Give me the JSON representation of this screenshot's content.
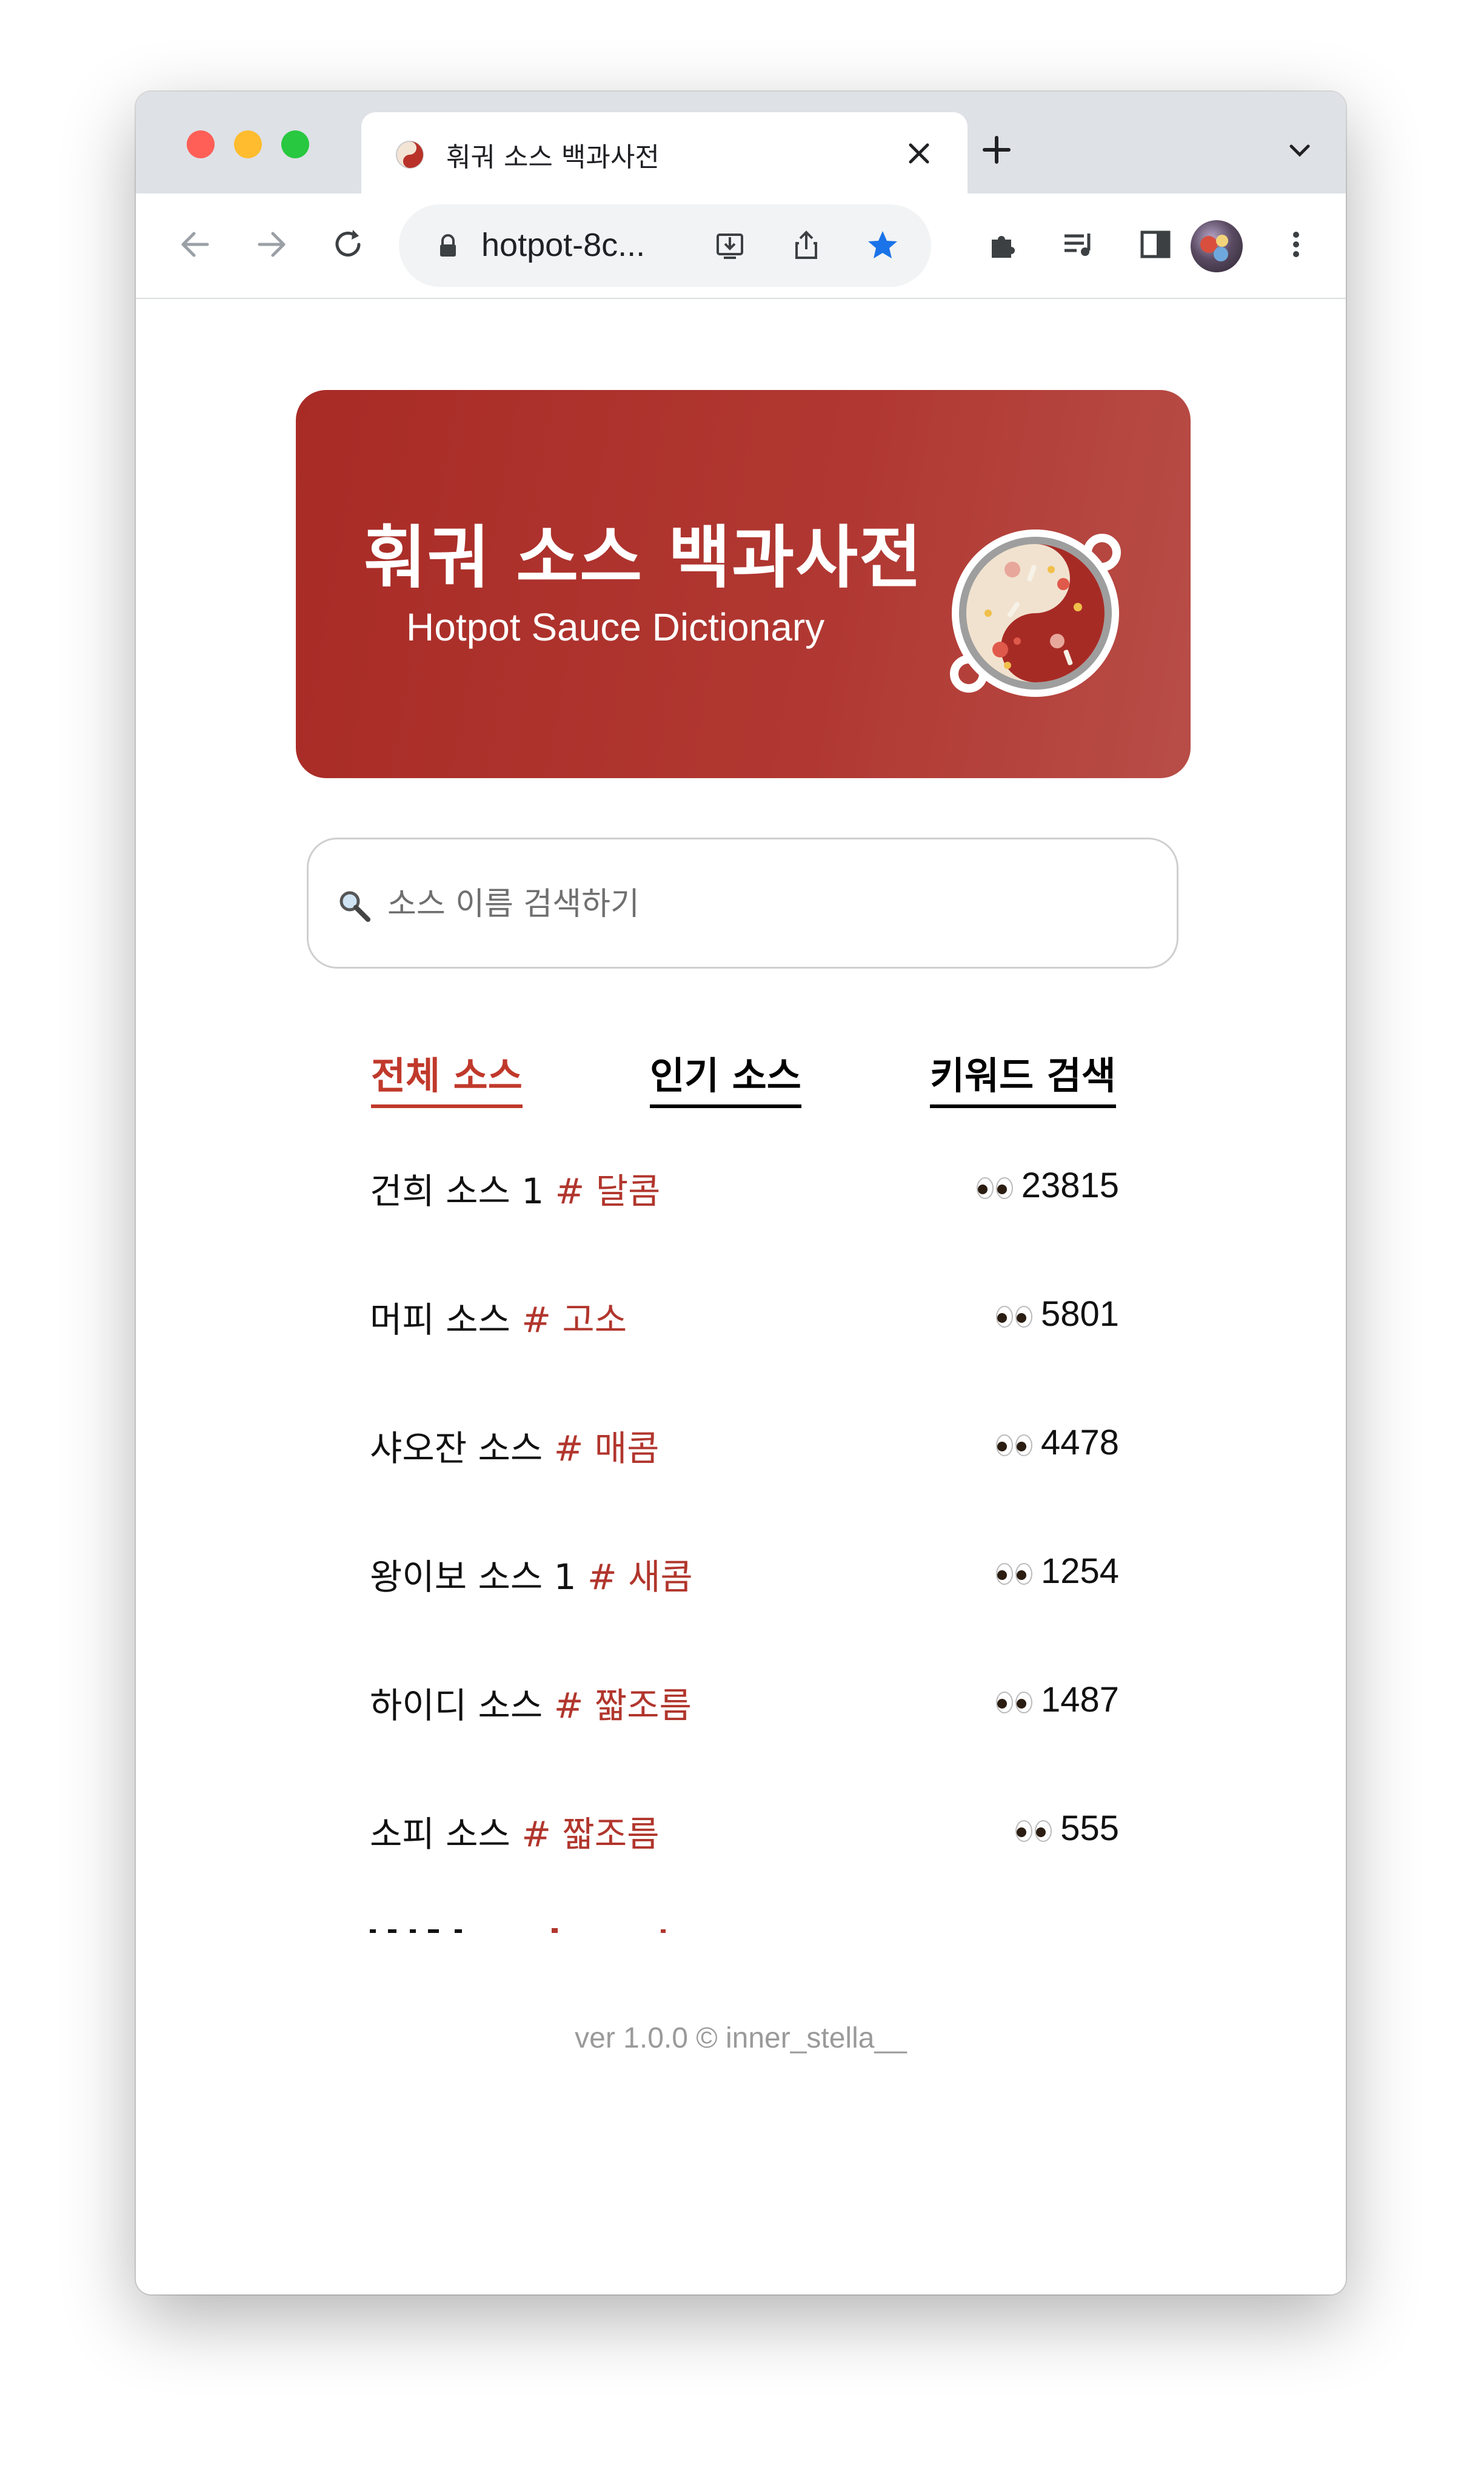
{
  "browser": {
    "tab_title": "훠궈 소스 백과사전",
    "url": "hotpot-8c..."
  },
  "hero": {
    "title": "훠궈 소스 백과사전",
    "subtitle": "Hotpot Sauce Dictionary"
  },
  "search": {
    "placeholder": "소스 이름 검색하기"
  },
  "tabs": [
    {
      "label": "전체 소스",
      "active": true
    },
    {
      "label": "인기 소스",
      "active": false
    },
    {
      "label": "키워드 검색",
      "active": false
    }
  ],
  "sauces": [
    {
      "name": "건희 소스 1",
      "tag": "# 달콤",
      "views": "23815"
    },
    {
      "name": "머피 소스",
      "tag": "# 고소",
      "views": "5801"
    },
    {
      "name": "샤오잔 소스",
      "tag": "# 매콤",
      "views": "4478"
    },
    {
      "name": "왕이보 소스 1",
      "tag": "# 새콤",
      "views": "1254"
    },
    {
      "name": "하이디 소스",
      "tag": "# 짧조름",
      "views": "1487"
    },
    {
      "name": "소피 소스",
      "tag": "# 짧조름",
      "views": "555"
    }
  ],
  "footer": "ver 1.0.0 © inner_stella__",
  "colors": {
    "accent": "#c0392b",
    "hero_start": "#a92b26",
    "hero_end": "#b84d47"
  }
}
